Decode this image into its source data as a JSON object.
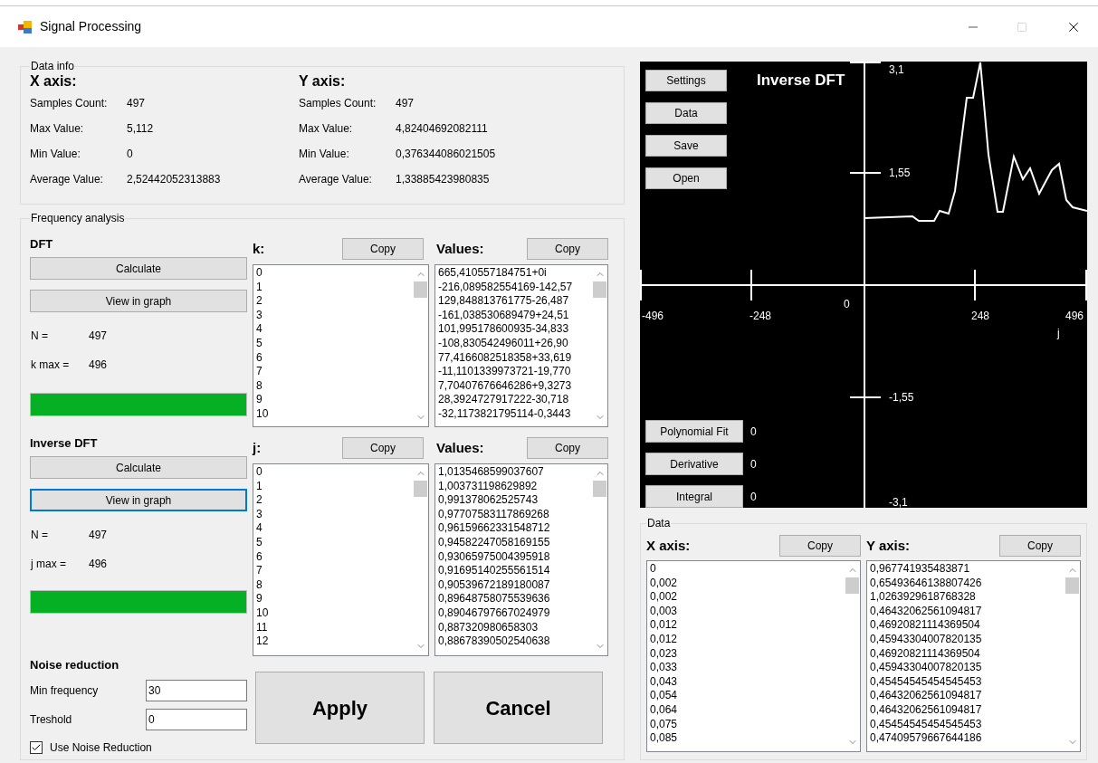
{
  "window": {
    "title": "Signal Processing"
  },
  "data_info": {
    "title": "Data info",
    "axes": [
      {
        "heading": "X axis:",
        "rows": [
          {
            "label": "Samples Count:",
            "value": "497"
          },
          {
            "label": "Max Value:",
            "value": "5,112"
          },
          {
            "label": "Min Value:",
            "value": "0"
          },
          {
            "label": "Average Value:",
            "value": "2,52442052313883"
          }
        ]
      },
      {
        "heading": "Y axis:",
        "rows": [
          {
            "label": "Samples Count:",
            "value": "497"
          },
          {
            "label": "Max Value:",
            "value": "4,82404692082111"
          },
          {
            "label": "Min Value:",
            "value": "0,376344086021505"
          },
          {
            "label": "Average Value:",
            "value": "1,33885423980835"
          }
        ]
      }
    ]
  },
  "frequency_analysis": {
    "title": "Frequency analysis",
    "sections": [
      {
        "heading": "DFT",
        "calculate": {
          "label": "Calculate",
          "focused": false
        },
        "view": {
          "label": "View in graph",
          "focused": false
        },
        "stats": [
          {
            "label": "N =",
            "value": "497"
          },
          {
            "label": "k max =",
            "value": "496"
          }
        ],
        "progress": {
          "level": 1
        },
        "index_list": {
          "label": "k:",
          "copy": "Copy",
          "items": [
            "0",
            "1",
            "2",
            "3",
            "4",
            "5",
            "6",
            "7",
            "8",
            "9",
            "10"
          ]
        },
        "values_list": {
          "label": "Values:",
          "copy": "Copy",
          "items": [
            "665,410557184751+0i",
            "-216,089582554169-142,57",
            "129,848813761775-26,487",
            "-161,038530689479+24,51",
            "101,995178600935-34,833",
            "-108,830542496011+26,90",
            "77,4166082518358+33,619",
            "-11,1101339973721-19,770",
            "7,70407676646286+9,3273",
            "28,3924727917222-30,718",
            "-32,1173821795114-0,3443"
          ]
        }
      },
      {
        "heading": "Inverse DFT",
        "calculate": {
          "label": "Calculate",
          "focused": false
        },
        "view": {
          "label": "View in graph",
          "focused": true
        },
        "stats": [
          {
            "label": "N =",
            "value": "497"
          },
          {
            "label": "j max =",
            "value": "496"
          }
        ],
        "progress": {
          "level": 1
        },
        "index_list": {
          "label": "j:",
          "copy": "Copy",
          "items": [
            "0",
            "1",
            "2",
            "3",
            "4",
            "5",
            "6",
            "7",
            "8",
            "9",
            "10",
            "11",
            "12"
          ]
        },
        "values_list": {
          "label": "Values:",
          "copy": "Copy",
          "items": [
            "1,0135468599037607",
            "1,003731198629892",
            "0,991378062525743",
            "0,97707583117869268",
            "0,96159662331548712",
            "0,94582247058169155",
            "0,93065975004395918",
            "0,91695140255561514",
            "0,90539672189180087",
            "0,89648758075539636",
            "0,89046797667024979",
            "0,887320980658303",
            "0,88678390502540638"
          ]
        }
      }
    ],
    "noise_reduction": {
      "heading": "Noise reduction",
      "fields": [
        {
          "label": "Min frequency",
          "value": "30"
        },
        {
          "label": "Treshold",
          "value": "0"
        }
      ],
      "checkbox": {
        "label": "Use Noise Reduction",
        "checked": true
      }
    },
    "buttons": [
      "Apply",
      "Cancel"
    ]
  },
  "graph": {
    "title": "Inverse DFT",
    "buttons": [
      "Settings",
      "Data",
      "Save",
      "Open"
    ],
    "tools": [
      {
        "label": "Polynomial Fit",
        "value": "0"
      },
      {
        "label": "Derivative",
        "value": "0"
      },
      {
        "label": "Integral",
        "value": "0"
      }
    ],
    "y_ticks": [
      "3,1",
      "1,55",
      "-1,55",
      "-3,1"
    ],
    "x_ticks": [
      "-496",
      "-248",
      "248",
      "496"
    ],
    "origin": "0",
    "x_axis_label": "j"
  },
  "data": {
    "title": "Data",
    "lists": [
      {
        "label": "X axis:",
        "copy": "Copy",
        "items": [
          "0",
          "0,002",
          "0,002",
          "0,003",
          "0,012",
          "0,012",
          "0,023",
          "0,033",
          "0,043",
          "0,054",
          "0,064",
          "0,075",
          "0,085"
        ]
      },
      {
        "label": "Y axis:",
        "copy": "Copy",
        "items": [
          "0,967741935483871",
          "0,65493646138807426",
          "1,0263929618768328",
          "0,46432062561094817",
          "0,46920821114369504",
          "0,45943304007820135",
          "0,46920821114369504",
          "0,45943304007820135",
          "0,45454545454545453",
          "0,46432062561094817",
          "0,46432062561094817",
          "0,45454545454545453",
          "0,47409579667644186"
        ]
      }
    ]
  }
}
